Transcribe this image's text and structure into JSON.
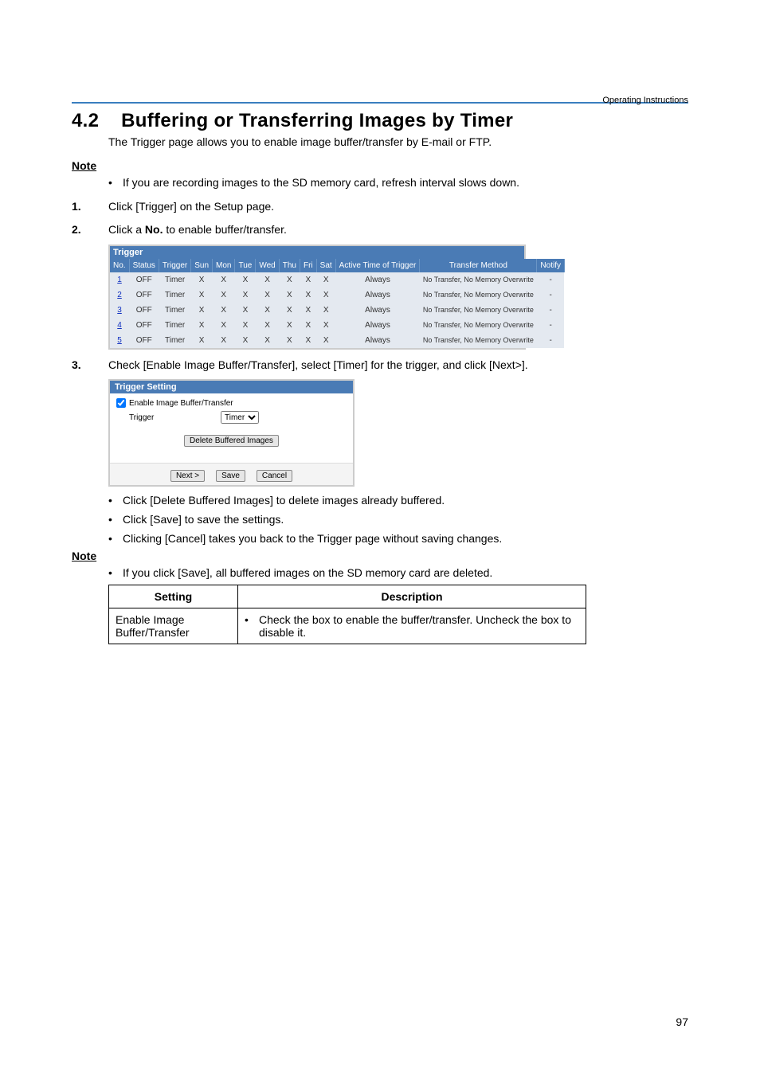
{
  "header": {
    "right": "Operating Instructions"
  },
  "section": {
    "number": "4.2",
    "title": "Buffering or Transferring Images by Timer",
    "intro": "The Trigger page allows you to enable image buffer/transfer by E-mail or FTP."
  },
  "note1": {
    "label": "Note",
    "bullets": [
      "If you are recording images to the SD memory card, refresh interval slows down."
    ]
  },
  "steps": [
    {
      "n": "1.",
      "text": "Click [Trigger] on the Setup page."
    },
    {
      "n": "2.",
      "text_prefix": "Click a ",
      "text_bold": "No.",
      "text_suffix": " to enable buffer/transfer."
    },
    {
      "n": "3.",
      "text": "Check [Enable Image Buffer/Transfer], select [Timer] for the trigger, and click [Next>]."
    }
  ],
  "trigger_table": {
    "caption": "Trigger",
    "headers": [
      "No.",
      "Status",
      "Trigger",
      "Sun",
      "Mon",
      "Tue",
      "Wed",
      "Thu",
      "Fri",
      "Sat",
      "Active Time of Trigger",
      "Transfer Method",
      "Notify"
    ],
    "rows": [
      {
        "no": "1",
        "status": "OFF",
        "trigger": "Timer",
        "days": [
          "X",
          "X",
          "X",
          "X",
          "X",
          "X",
          "X"
        ],
        "active": "Always",
        "method": "No Transfer, No Memory Overwrite",
        "notify": "-"
      },
      {
        "no": "2",
        "status": "OFF",
        "trigger": "Timer",
        "days": [
          "X",
          "X",
          "X",
          "X",
          "X",
          "X",
          "X"
        ],
        "active": "Always",
        "method": "No Transfer, No Memory Overwrite",
        "notify": "-"
      },
      {
        "no": "3",
        "status": "OFF",
        "trigger": "Timer",
        "days": [
          "X",
          "X",
          "X",
          "X",
          "X",
          "X",
          "X"
        ],
        "active": "Always",
        "method": "No Transfer, No Memory Overwrite",
        "notify": "-"
      },
      {
        "no": "4",
        "status": "OFF",
        "trigger": "Timer",
        "days": [
          "X",
          "X",
          "X",
          "X",
          "X",
          "X",
          "X"
        ],
        "active": "Always",
        "method": "No Transfer, No Memory Overwrite",
        "notify": "-"
      },
      {
        "no": "5",
        "status": "OFF",
        "trigger": "Timer",
        "days": [
          "X",
          "X",
          "X",
          "X",
          "X",
          "X",
          "X"
        ],
        "active": "Always",
        "method": "No Transfer, No Memory Overwrite",
        "notify": "-"
      }
    ]
  },
  "trigger_setting": {
    "caption": "Trigger Setting",
    "enable_label": "Enable Image Buffer/Transfer",
    "enable_checked": true,
    "trigger_label": "Trigger",
    "trigger_option": "Timer",
    "delete_btn": "Delete Buffered Images",
    "next_btn": "Next >",
    "save_btn": "Save",
    "cancel_btn": "Cancel"
  },
  "step3_bullets": [
    "Click [Delete Buffered Images] to delete images already buffered.",
    "Click [Save] to save the settings.",
    "Clicking [Cancel] takes you back to the Trigger page without saving changes."
  ],
  "note2": {
    "label": "Note",
    "bullets": [
      "If you click [Save], all buffered images on the SD memory card are deleted."
    ]
  },
  "settings_table": {
    "headers": [
      "Setting",
      "Description"
    ],
    "rows": [
      {
        "setting": "Enable Image Buffer/Transfer",
        "desc": "Check the box to enable the buffer/transfer. Uncheck the box to disable it."
      }
    ]
  },
  "page_number": "97"
}
